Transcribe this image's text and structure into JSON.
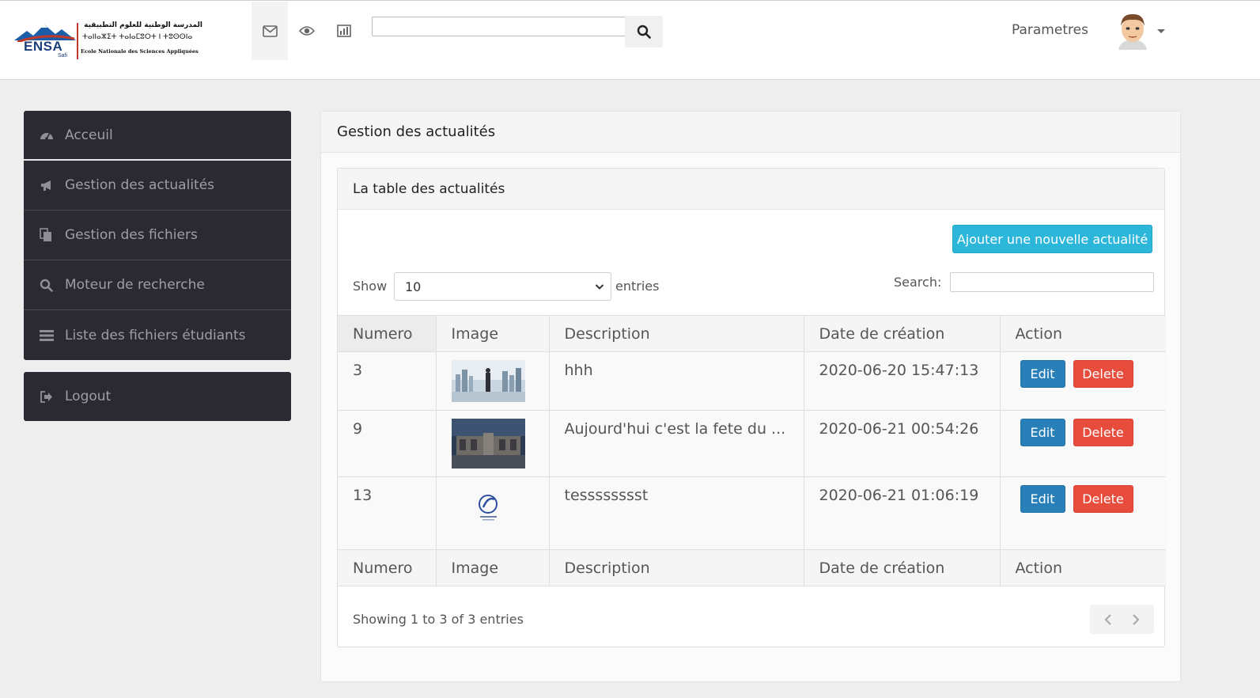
{
  "header": {
    "logo": {
      "brand": "ENSA",
      "city": "Safi",
      "arabic": "المدرسة الوطنية للعلوم التطبيقية",
      "tifinagh": "ⵜⴰⵏⵏⴰⵣⵉⵜ ⵜⴰⵏⴰⵎⵓⵔⵜ ⵏ ⵜⵓⵙⵙⵏⴰ",
      "french": "Ecole Nationale des Sciences Appliquées",
      "brand_color": "#1c3f7a",
      "accent_color": "#c0392b"
    },
    "nav_icons": [
      "envelope-icon",
      "eye-icon",
      "bar-chart-icon"
    ],
    "search": {
      "value": "",
      "placeholder": ""
    },
    "settings_label": "Parametres"
  },
  "sidebar": {
    "items": [
      {
        "label": "Acceuil",
        "icon": "dashboard-icon"
      },
      {
        "label": "Gestion des actualités",
        "icon": "bullhorn-icon"
      },
      {
        "label": "Gestion des fichiers",
        "icon": "files-icon"
      },
      {
        "label": "Moteur de recherche",
        "icon": "search-icon"
      },
      {
        "label": "Liste des fichiers étudiants",
        "icon": "list-icon"
      }
    ],
    "logout_label": "Logout"
  },
  "main": {
    "title": "Gestion des actualités",
    "table_panel": {
      "title": "La table des actualités",
      "add_button": "Ajouter une nouvelle actualité",
      "show_label": "Show",
      "show_value": "10",
      "entries_label": "entries",
      "search_label": "Search:",
      "search_value": "",
      "columns": [
        "Numero",
        "Image",
        "Description",
        "Date de création",
        "Action"
      ],
      "rows": [
        {
          "numero": "3",
          "description": "hhh",
          "date": "2020-06-20 15:47:13",
          "image": "city-skyline-image"
        },
        {
          "numero": "9",
          "description": "Aujourd'hui c'est la fete du ...",
          "date": "2020-06-21 00:54:26",
          "image": "building-photo-image"
        },
        {
          "numero": "13",
          "description": "tesssssssst",
          "date": "2020-06-21 01:06:19",
          "image": "logo-image"
        }
      ],
      "edit_label": "Edit",
      "delete_label": "Delete",
      "info": "Showing 1 to 3 of 3 entries"
    }
  },
  "colors": {
    "sidebar_bg": "#2b2a33",
    "add_button": "#2bb6da",
    "edit_button": "#2980b9",
    "delete_button": "#e74c3c"
  }
}
